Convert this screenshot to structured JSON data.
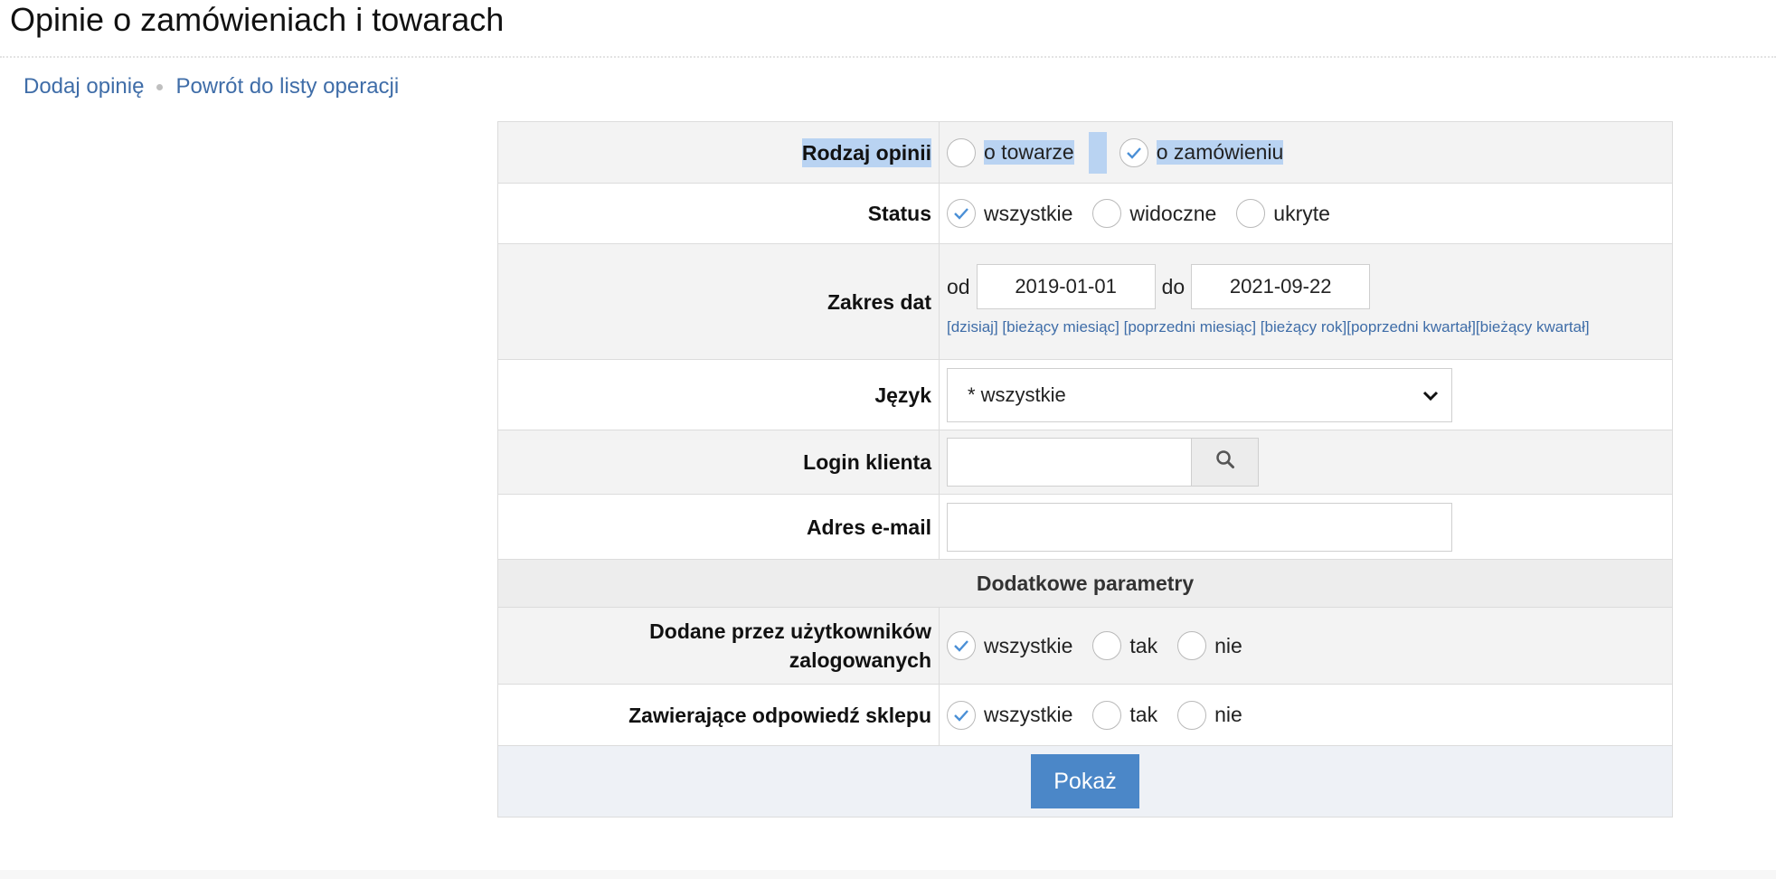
{
  "page": {
    "title": "Opinie o zamówieniach i towarach"
  },
  "subnav": {
    "add_opinion": "Dodaj opinię",
    "back": "Powrót do listy operacji"
  },
  "form": {
    "type": {
      "label": "Rodzaj opinii",
      "options": [
        "o towarze",
        "o zamówieniu"
      ],
      "selected": "o zamówieniu"
    },
    "status": {
      "label": "Status",
      "options": [
        "wszystkie",
        "widoczne",
        "ukryte"
      ],
      "selected": "wszystkie"
    },
    "dates": {
      "label": "Zakres dat",
      "from_label": "od",
      "from_value": "2019-01-01",
      "to_label": "do",
      "to_value": "2021-09-22",
      "quick_links": [
        "[dzisiaj]",
        "[bieżący miesiąc]",
        "[poprzedni miesiąc]",
        "[bieżący rok]",
        "[poprzedni kwartał]",
        "[bieżący kwartał]"
      ]
    },
    "language": {
      "label": "Język",
      "selected": "* wszystkie"
    },
    "login": {
      "label": "Login klienta",
      "value": ""
    },
    "email": {
      "label": "Adres e-mail",
      "value": ""
    },
    "section_title": "Dodatkowe parametry",
    "logged_users": {
      "label_line1": "Dodane przez użytkowników",
      "label_line2": "zalogowanych",
      "options": [
        "wszystkie",
        "tak",
        "nie"
      ],
      "selected": "wszystkie"
    },
    "shop_reply": {
      "label": "Zawierające odpowiedź sklepu",
      "options": [
        "wszystkie",
        "tak",
        "nie"
      ],
      "selected": "wszystkie"
    },
    "submit_label": "Pokaż"
  },
  "colors": {
    "link": "#3f6da8",
    "check": "#4a8fd6",
    "button": "#4b87c8",
    "selection_highlight": "#b9d3f2"
  }
}
